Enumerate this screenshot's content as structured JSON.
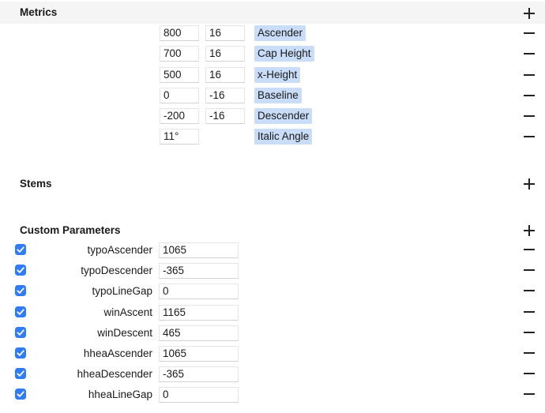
{
  "metrics": {
    "title": "Metrics",
    "rows": [
      {
        "value": "800",
        "overshoot": "16",
        "label": "Ascender"
      },
      {
        "value": "700",
        "overshoot": "16",
        "label": "Cap Height"
      },
      {
        "value": "500",
        "overshoot": "16",
        "label": "x-Height"
      },
      {
        "value": "0",
        "overshoot": "-16",
        "label": "Baseline"
      },
      {
        "value": "-200",
        "overshoot": "-16",
        "label": "Descender"
      },
      {
        "value": "11°",
        "overshoot": null,
        "label": "Italic Angle"
      }
    ]
  },
  "stems": {
    "title": "Stems"
  },
  "custom_parameters": {
    "title": "Custom Parameters",
    "rows": [
      {
        "name": "typoAscender",
        "value": "1065",
        "checked": true
      },
      {
        "name": "typoDescender",
        "value": "-365",
        "checked": true
      },
      {
        "name": "typoLineGap",
        "value": "0",
        "checked": true
      },
      {
        "name": "winAscent",
        "value": "1165",
        "checked": true
      },
      {
        "name": "winDescent",
        "value": "465",
        "checked": true
      },
      {
        "name": "hheaAscender",
        "value": "1065",
        "checked": true
      },
      {
        "name": "hheaDescender",
        "value": "-365",
        "checked": true
      },
      {
        "name": "hheaLineGap",
        "value": "0",
        "checked": true
      }
    ]
  },
  "colors": {
    "checkbox_accent": "#2f7cf6",
    "tag_background": "#c9dcf8",
    "header_background": "#f5f5f5"
  }
}
